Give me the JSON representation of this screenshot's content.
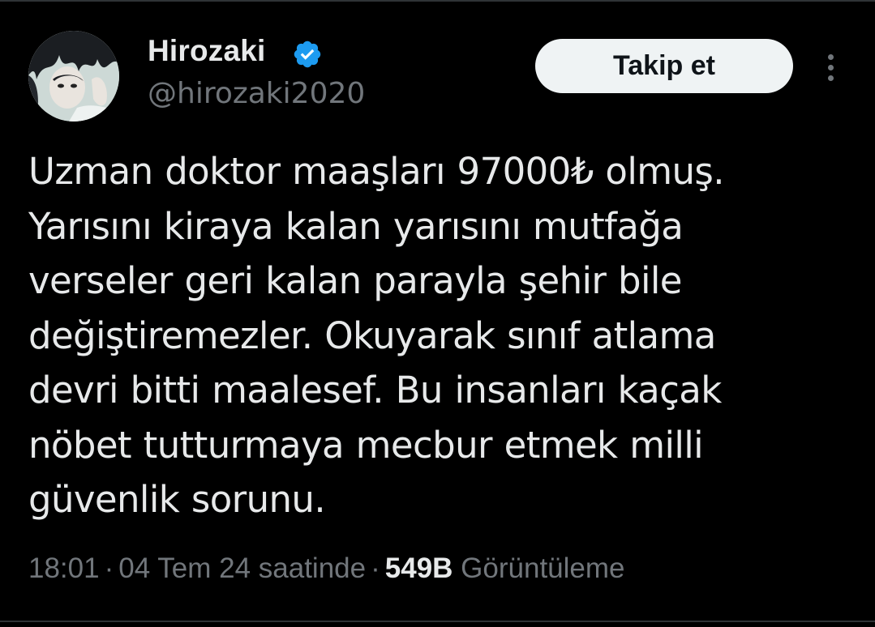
{
  "author": {
    "display_name": "Hirozaki",
    "handle": "@hirozaki2020",
    "verified_icon": "verified-badge-icon",
    "verified_color": "#1d9bf0"
  },
  "actions": {
    "follow_label": "Takip et",
    "more_icon": "more-options-icon"
  },
  "tweet": {
    "lines": [
      "Uzman doktor maaşları 97000₺ olmuş.",
      "Yarısını kiraya kalan yarısını mutfağa",
      "verseler geri kalan parayla şehir bile",
      "değiştiremezler. Okuyarak sınıf atlama",
      "devri bitti maalesef. Bu insanları kaçak",
      "nöbet tutturmaya mecbur etmek milli",
      "güvenlik sorunu."
    ]
  },
  "meta": {
    "time": "18:01",
    "separator": "·",
    "date": "04 Tem 24 saatinde",
    "views_count": "549B",
    "views_label": "Görüntüleme"
  },
  "colors": {
    "background": "#000000",
    "text_primary": "#e7e9ea",
    "text_secondary": "#71767b",
    "button_bg": "#eff3f4",
    "button_text": "#0f1419"
  }
}
